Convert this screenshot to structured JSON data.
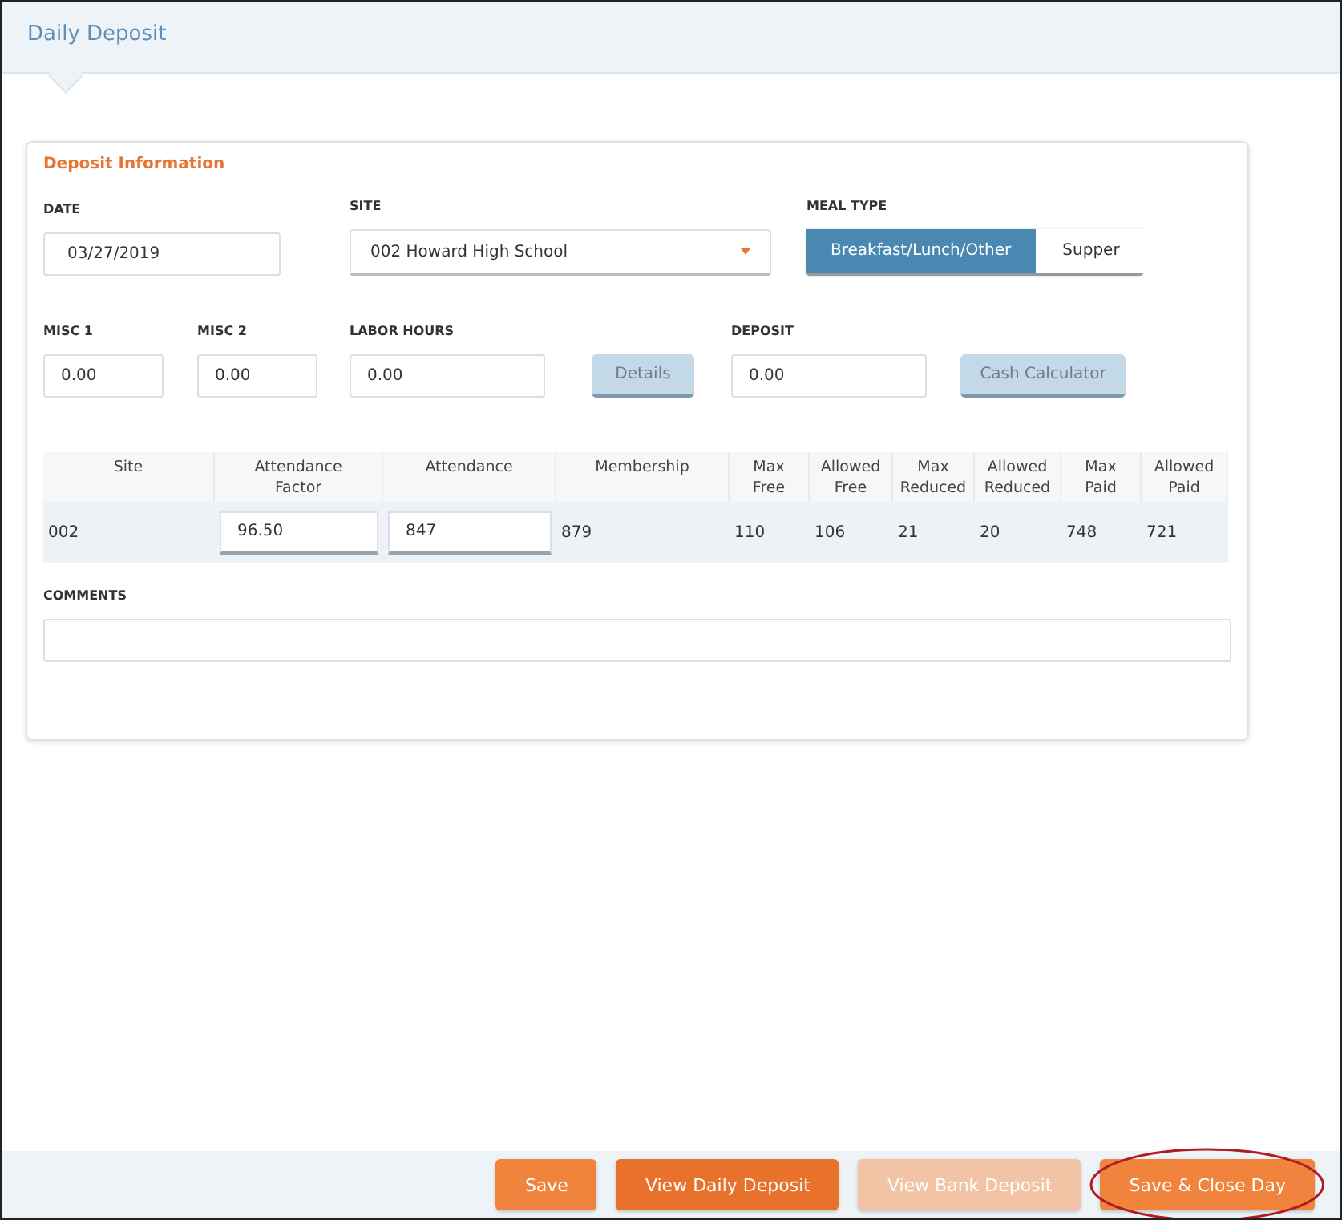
{
  "header": {
    "title": "Daily Deposit"
  },
  "section": {
    "title": "Deposit Information",
    "date": {
      "label": "DATE",
      "value": "03/27/2019"
    },
    "site": {
      "label": "SITE",
      "value": "002 Howard High School"
    },
    "meal_type": {
      "label": "MEAL TYPE",
      "options": [
        {
          "label": "Breakfast/Lunch/Other",
          "selected": true
        },
        {
          "label": "Supper",
          "selected": false
        }
      ]
    },
    "misc1": {
      "label": "MISC 1",
      "value": "0.00"
    },
    "misc2": {
      "label": "MISC 2",
      "value": "0.00"
    },
    "labor_hours": {
      "label": "LABOR HOURS",
      "value": "0.00"
    },
    "details_button": "Details",
    "deposit": {
      "label": "DEPOSIT",
      "value": "0.00"
    },
    "cash_calculator_button": "Cash Calculator",
    "table": {
      "columns": [
        "Site",
        "Attendance Factor",
        "Attendance",
        "Membership",
        "Max Free",
        "Allowed Free",
        "Max Reduced",
        "Allowed Reduced",
        "Max Paid",
        "Allowed Paid"
      ],
      "rows": [
        {
          "cells": [
            {
              "kind": "text",
              "value": "002"
            },
            {
              "kind": "input",
              "value": "96.50"
            },
            {
              "kind": "input",
              "value": "847"
            },
            {
              "kind": "text",
              "value": "879"
            },
            {
              "kind": "text",
              "value": "110"
            },
            {
              "kind": "text",
              "value": "106"
            },
            {
              "kind": "text",
              "value": "21"
            },
            {
              "kind": "text",
              "value": "20"
            },
            {
              "kind": "text",
              "value": "748"
            },
            {
              "kind": "text",
              "value": "721"
            }
          ]
        }
      ]
    },
    "comments": {
      "label": "COMMENTS"
    }
  },
  "footer": {
    "buttons": [
      {
        "label": "Save",
        "kind": "light",
        "disabled": false,
        "highlighted": false
      },
      {
        "label": "View Daily Deposit",
        "kind": "dark",
        "disabled": false,
        "highlighted": false
      },
      {
        "label": "View Bank Deposit",
        "kind": "light",
        "disabled": true,
        "highlighted": false
      },
      {
        "label": "Save & Close Day",
        "kind": "light",
        "disabled": false,
        "highlighted": true
      }
    ]
  }
}
